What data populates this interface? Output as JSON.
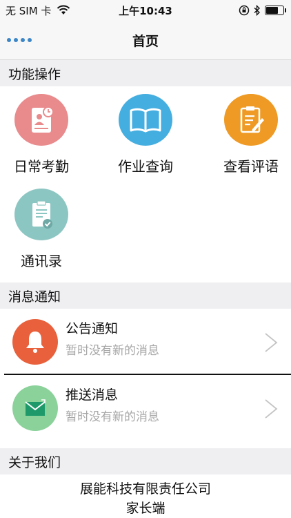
{
  "status_bar": {
    "carrier": "无 SIM 卡",
    "time": "上午10:43",
    "battery_level": 0.75
  },
  "nav": {
    "title": "首页"
  },
  "functions": {
    "header": "功能操作",
    "items": [
      {
        "label": "日常考勤",
        "icon": "attendance-icon",
        "color": "#e98a8c"
      },
      {
        "label": "作业查询",
        "icon": "book-icon",
        "color": "#45aee0"
      },
      {
        "label": "查看评语",
        "icon": "clipboard-pen-icon",
        "color": "#ee9a24"
      },
      {
        "label": "通讯录",
        "icon": "contacts-clipboard-icon",
        "color": "#8cc6c2"
      }
    ]
  },
  "messages": {
    "header": "消息通知",
    "items": [
      {
        "title": "公告通知",
        "subtitle": "暂时没有新的消息",
        "icon": "bell-icon",
        "color": "#e8613c"
      },
      {
        "title": "推送消息",
        "subtitle": "暂时没有新的消息",
        "icon": "mail-icon",
        "color": "#8bd29a"
      }
    ]
  },
  "about": {
    "header": "关于我们",
    "company": "展能科技有限责任公司",
    "app_name": "家长端"
  }
}
